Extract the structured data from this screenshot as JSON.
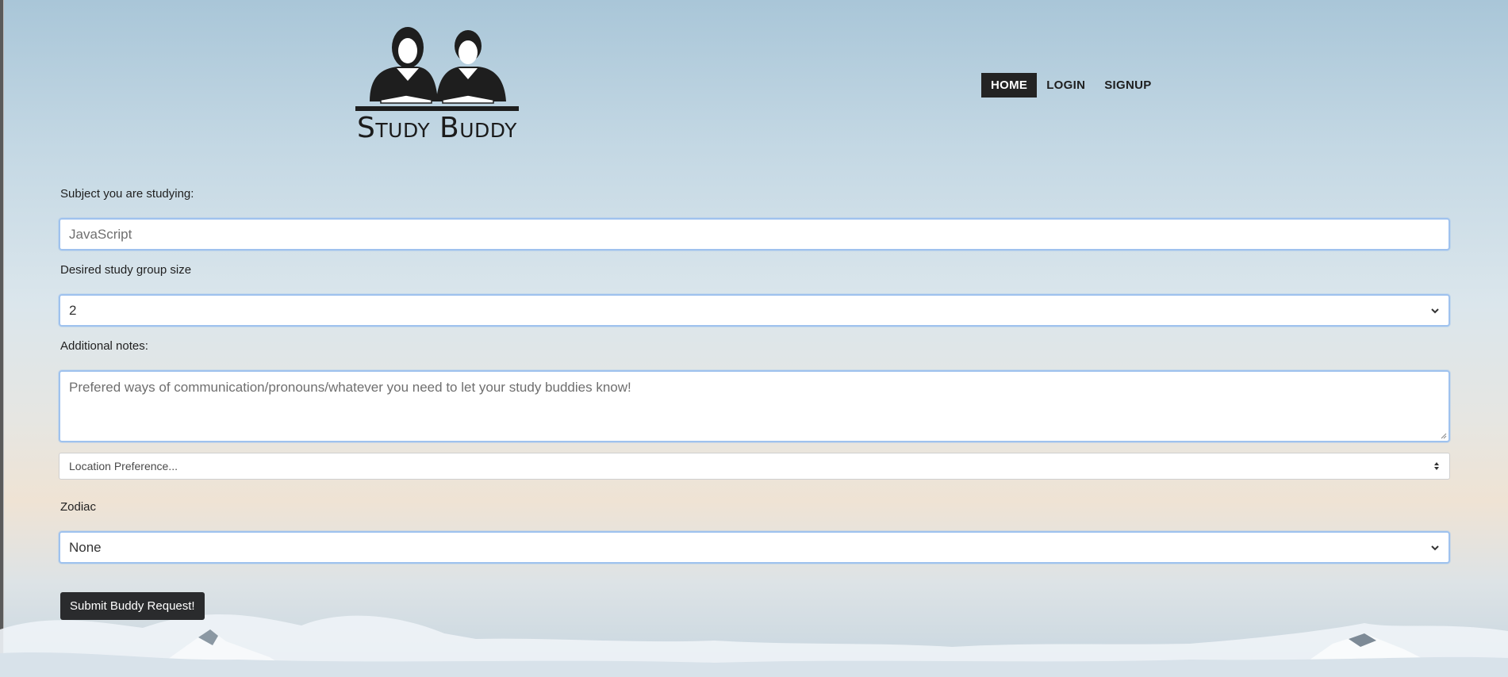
{
  "app": {
    "brand_name": "Study Buddy"
  },
  "nav": {
    "items": [
      {
        "label": "HOME",
        "active": true
      },
      {
        "label": "LOGIN",
        "active": false
      },
      {
        "label": "SIGNUP",
        "active": false
      }
    ]
  },
  "form": {
    "subject": {
      "label": "Subject you are studying:",
      "placeholder": "JavaScript"
    },
    "group_size": {
      "label": "Desired study group size",
      "selected": "2"
    },
    "notes": {
      "label": "Additional notes:",
      "placeholder": "Prefered ways of communication/pronouns/whatever you need to let your study buddies know!"
    },
    "location": {
      "selected": "Location Preference..."
    },
    "zodiac": {
      "label": "Zodiac",
      "selected": "None"
    },
    "submit_label": "Submit Buddy Request!"
  },
  "colors": {
    "nav_active_bg": "#232323",
    "focus_border": "#9fc2ee",
    "button_bg": "#2a2b2d"
  }
}
